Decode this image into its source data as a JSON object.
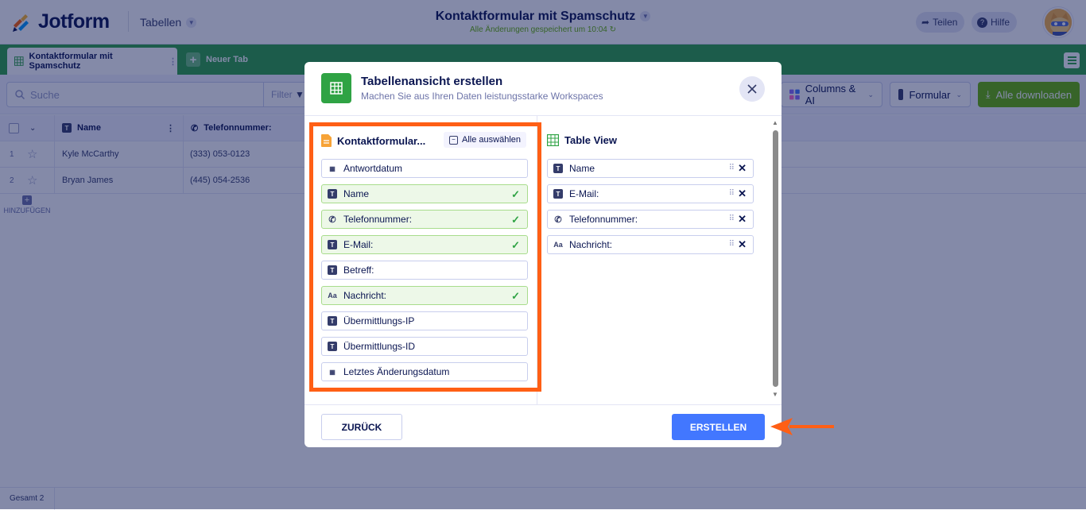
{
  "header": {
    "brand": "Jotform",
    "tables_menu": "Tabellen",
    "title": "Kontaktformular mit Spamschutz",
    "save_status": "Alle Änderungen gespeichert um 10:04",
    "share_label": "Teilen",
    "help_label": "Hilfe"
  },
  "tabs": {
    "active_label": "Kontaktformular mit Spamschutz",
    "new_tab_label": "Neuer Tab"
  },
  "toolbar": {
    "search_placeholder": "Suche",
    "filter_label": "Filter",
    "columns_label": "Columns & AI",
    "form_label": "Formular",
    "download_label": "Alle downloaden"
  },
  "table": {
    "columns": [
      "Name",
      "Telefonnummer:"
    ],
    "rows": [
      {
        "num": "1",
        "name": "Kyle McCarthy",
        "phone": "(333) 053-0123"
      },
      {
        "num": "2",
        "name": "Bryan James",
        "phone": "(445) 054-2536"
      }
    ],
    "add_label": "HINZUFÜGEN",
    "total_label": "Gesamt 2"
  },
  "modal": {
    "title": "Tabellenansicht erstellen",
    "subtitle": "Machen Sie aus Ihren Daten leistungsstarke Workspaces",
    "left_title": "Kontaktformular...",
    "select_all": "Alle auswählen",
    "fields": [
      {
        "label": "Antwortdatum",
        "icon": "calendar-icon",
        "selected": false
      },
      {
        "label": "Name",
        "icon": "text-icon",
        "selected": true
      },
      {
        "label": "Telefonnummer:",
        "icon": "phone-icon",
        "selected": true
      },
      {
        "label": "E-Mail:",
        "icon": "text-icon",
        "selected": true
      },
      {
        "label": "Betreff:",
        "icon": "text-icon",
        "selected": false
      },
      {
        "label": "Nachricht:",
        "icon": "textarea-icon",
        "selected": true
      },
      {
        "label": "Übermittlungs-IP",
        "icon": "text-icon",
        "selected": false
      },
      {
        "label": "Übermittlungs-ID",
        "icon": "text-icon",
        "selected": false
      },
      {
        "label": "Letztes Änderungsdatum",
        "icon": "calendar-icon",
        "selected": false
      }
    ],
    "right_title": "Table View",
    "selected_fields": [
      {
        "label": "Name",
        "icon": "text-icon"
      },
      {
        "label": "E-Mail:",
        "icon": "text-icon"
      },
      {
        "label": "Telefonnummer:",
        "icon": "phone-icon"
      },
      {
        "label": "Nachricht:",
        "icon": "textarea-icon"
      }
    ],
    "back_label": "ZURÜCK",
    "create_label": "ERSTELLEN"
  },
  "colors": {
    "green": "#2fa344",
    "blue": "#4277ff",
    "highlight": "#ff5f15",
    "navy": "#0a1551"
  }
}
